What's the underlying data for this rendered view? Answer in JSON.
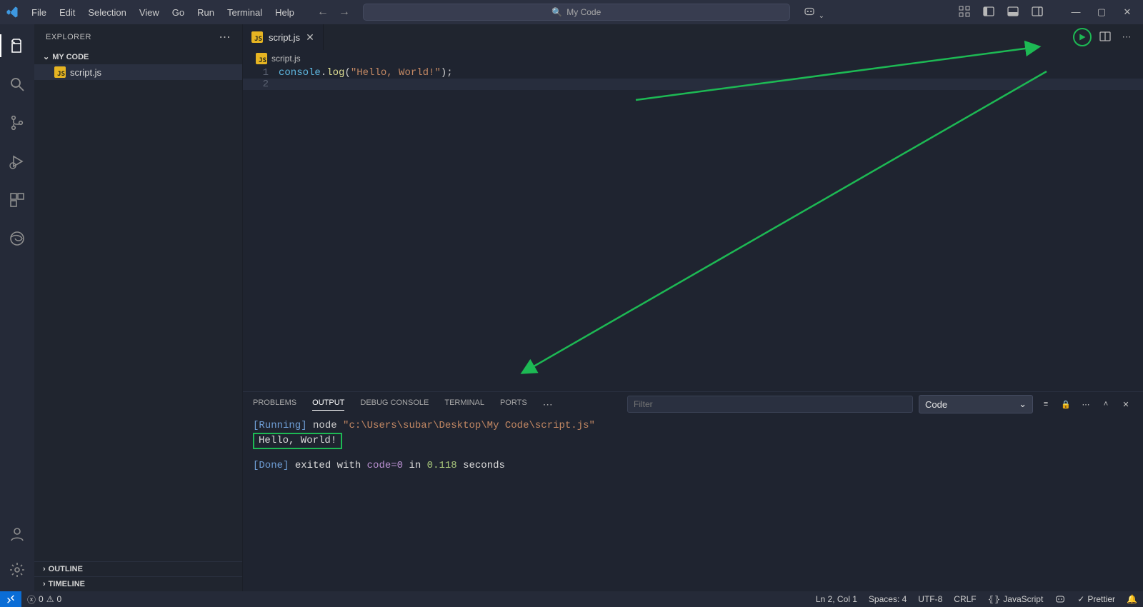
{
  "titlebar": {
    "menus": [
      "File",
      "Edit",
      "Selection",
      "View",
      "Go",
      "Run",
      "Terminal",
      "Help"
    ],
    "search_text": "My Code"
  },
  "activitybar": {
    "items": [
      "explorer",
      "search",
      "source-control",
      "run-debug",
      "extensions",
      "edge-tools"
    ]
  },
  "sidebar": {
    "title": "EXPLORER",
    "folder": "MY CODE",
    "file": "script.js",
    "outline": "OUTLINE",
    "timeline": "TIMELINE"
  },
  "tabs": {
    "active": "script.js",
    "breadcrumb": "script.js"
  },
  "editor": {
    "line1_obj": "console",
    "line1_dot": ".",
    "line1_func": "log",
    "line1_open": "(",
    "line1_str": "\"Hello, World!\"",
    "line1_close": ");",
    "lineno1": "1",
    "lineno2": "2"
  },
  "panel": {
    "tabs": {
      "problems": "PROBLEMS",
      "output": "OUTPUT",
      "debug": "DEBUG CONSOLE",
      "terminal": "TERMINAL",
      "ports": "PORTS"
    },
    "filter_placeholder": "Filter",
    "channel": "Code",
    "output": {
      "running_tag": "[Running]",
      "running_cmd": " node ",
      "running_path": "\"c:\\Users\\subar\\Desktop\\My Code\\script.js\"",
      "hello": "Hello, World!",
      "done_tag": "[Done]",
      "done_txt1": " exited with ",
      "done_code": "code=0",
      "done_txt2": " in ",
      "done_secs": "0.118",
      "done_txt3": " seconds"
    }
  },
  "statusbar": {
    "errors": "0",
    "warnings": "0",
    "position": "Ln 2, Col 1",
    "spaces": "Spaces: 4",
    "encoding": "UTF-8",
    "eol": "CRLF",
    "language": "JavaScript",
    "prettier": "Prettier"
  }
}
